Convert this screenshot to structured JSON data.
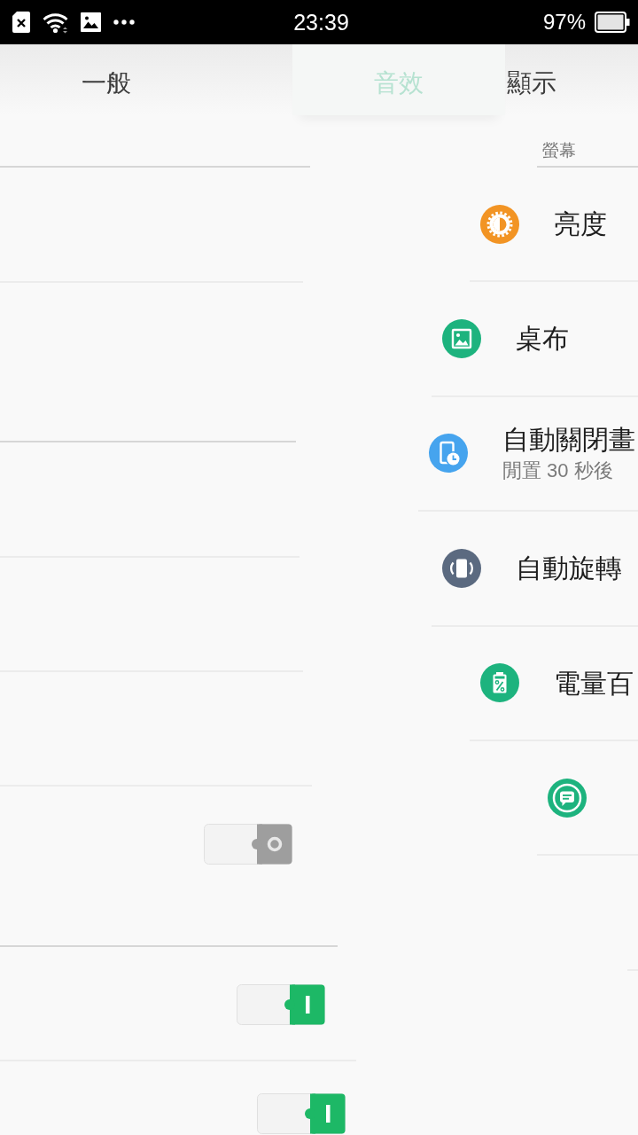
{
  "status_bar": {
    "time": "23:39",
    "battery_text": "97%"
  },
  "tabs": [
    {
      "label": "一般",
      "selected": false
    },
    {
      "label": "音效",
      "selected": true
    },
    {
      "label": "顯示",
      "selected": false
    }
  ],
  "general_page": {
    "switches": [
      {
        "on": false
      },
      {
        "on": true
      },
      {
        "on": true
      }
    ]
  },
  "display_page": {
    "section_title": "螢幕",
    "items": [
      {
        "title": "亮度",
        "color": "#f29424"
      },
      {
        "title": "桌布",
        "color": "#1db37e"
      },
      {
        "title": "自動關閉畫",
        "subtitle": "閒置 30 秒後",
        "color": "#46a4ee"
      },
      {
        "title": "自動旋轉",
        "color": "#5b6a80"
      },
      {
        "title": "電量百",
        "color": "#1db37e"
      },
      {
        "color": "#1db37e"
      }
    ]
  }
}
